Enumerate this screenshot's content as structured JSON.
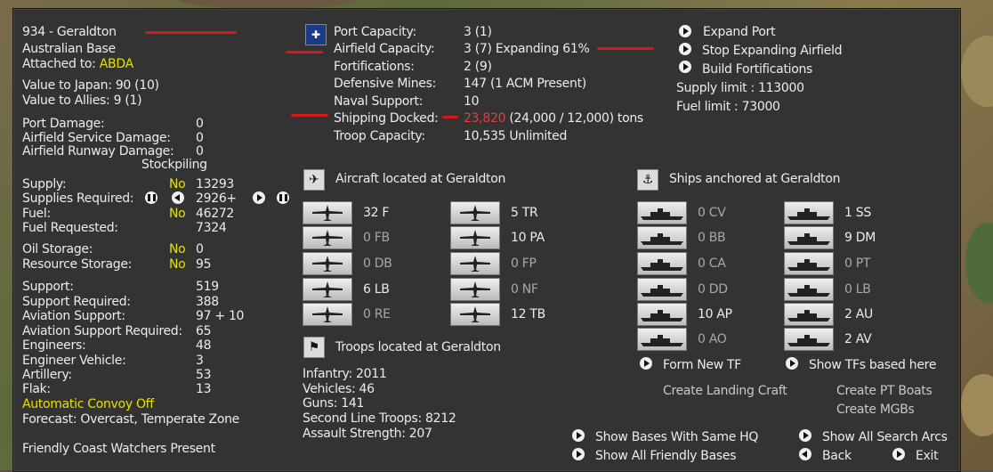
{
  "base": {
    "title": "934 - Geraldton",
    "type": "Australian Base",
    "attached_label": "Attached to:",
    "attached_value": "ABDA",
    "value_japan": "Value to Japan: 90 (10)",
    "value_allies": "Value to Allies: 9 (1)"
  },
  "damage": [
    {
      "label": "Port Damage:",
      "value": "0"
    },
    {
      "label": "Airfield Service Damage:",
      "value": "0"
    },
    {
      "label": "Airfield Runway Damage:",
      "value": "0"
    }
  ],
  "stockpiling_label": "Stockpiling",
  "supply": [
    {
      "label": "Supply:",
      "flag": "No",
      "value": "13293"
    },
    {
      "label": "Supplies Required:",
      "flag": "",
      "value": "2926+"
    },
    {
      "label": "Fuel:",
      "flag": "No",
      "value": "46272"
    },
    {
      "label": "Fuel Requested:",
      "flag": "",
      "value": "7324"
    }
  ],
  "storage": [
    {
      "label": "Oil Storage:",
      "flag": "No",
      "value": "0"
    },
    {
      "label": "Resource Storage:",
      "flag": "No",
      "value": "95"
    }
  ],
  "support": [
    {
      "label": "Support:",
      "value": "519"
    },
    {
      "label": "Support Required:",
      "value": "388"
    },
    {
      "label": "Aviation Support:",
      "value": "97 + 10"
    },
    {
      "label": "Aviation Support Required:",
      "value": "65"
    },
    {
      "label": "Engineers:",
      "value": "48"
    },
    {
      "label": "Engineer Vehicle:",
      "value": "3"
    },
    {
      "label": "Artillery:",
      "value": "53"
    },
    {
      "label": "Flak:",
      "value": "13"
    }
  ],
  "convoy_label": "Automatic Convoy Off",
  "forecast": "Forecast: Overcast, Temperate Zone",
  "coast_watchers": "Friendly Coast Watchers Present",
  "port": [
    {
      "label": "Port Capacity:",
      "value": "3 (1)"
    },
    {
      "label": "Airfield Capacity:",
      "value": "3 (7) Expanding 61%"
    },
    {
      "label": "Fortifications:",
      "value": "2 (9)"
    },
    {
      "label": "Defensive Mines:",
      "value": "147 (1 ACM Present)"
    },
    {
      "label": "Naval Support:",
      "value": "10"
    },
    {
      "label": "Shipping Docked:",
      "value_red": "23,820",
      "value": "(24,000 / 12,000) tons"
    },
    {
      "label": "Troop Capacity:",
      "value": "10,535   Unlimited"
    }
  ],
  "actions": {
    "expand_port": "Expand Port",
    "stop_expanding": "Stop Expanding Airfield",
    "build_fort": "Build Fortifications",
    "supply_limit": "Supply limit : 113000",
    "fuel_limit": "Fuel limit : 73000"
  },
  "aircraft": {
    "header": "Aircraft located at Geraldton",
    "left": [
      "32 F",
      "0 FB",
      "0 DB",
      "6 LB",
      "0 RE"
    ],
    "right": [
      "5 TR",
      "10 PA",
      "0 FP",
      "0 NF",
      "12 TB"
    ]
  },
  "ships": {
    "header": "Ships anchored at Geraldton",
    "left": [
      "0 CV",
      "0 BB",
      "0 CA",
      "0 DD",
      "10 AP",
      "0 AO"
    ],
    "right": [
      "1 SS",
      "9 DM",
      "0 PT",
      "0 LB",
      "2 AU",
      "2 AV"
    ]
  },
  "troops": {
    "header": "Troops located at Geraldton",
    "lines": [
      "Infantry: 2011",
      "Vehicles: 46",
      "Guns: 141",
      "Second Line Troops: 8212",
      "Assault Strength: 207"
    ]
  },
  "tf": {
    "form": "Form New TF",
    "show": "Show TFs based here",
    "landing": "Create Landing Craft",
    "pt": "Create PT Boats",
    "mgb": "Create MGBs"
  },
  "bottom": {
    "same_hq": "Show Bases With Same HQ",
    "all_friendly": "Show All Friendly Bases",
    "search_arcs": "Show All Search Arcs",
    "back": "Back",
    "exit": "Exit"
  }
}
